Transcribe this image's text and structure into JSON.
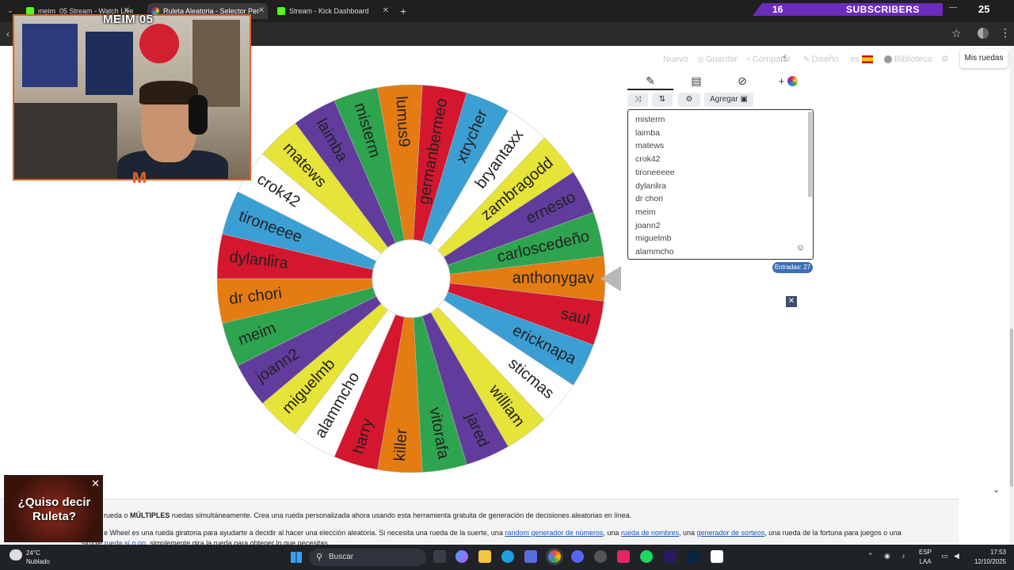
{
  "browser": {
    "tabs": [
      {
        "label": "meim_05 Stream - Watch Live o",
        "favicon_color": "#53fc18",
        "active": false
      },
      {
        "label": "Ruleta Aleatoria - Selector Per",
        "favicon_color": "#d946a8",
        "active": true
      },
      {
        "label": "Stream - Kick Dashboard",
        "favicon_color": "#53fc18",
        "active": false
      }
    ],
    "new_tab": "+"
  },
  "stream_overlay": {
    "streamer_name": "MEIM 05",
    "subscriber_count": "16",
    "subscriber_label": "SUBSCRIBERS",
    "corner_number": "25",
    "accent": "#6d2bbd",
    "frame_color": "#e0622a"
  },
  "site_menu": {
    "nuevo": "Nuevo",
    "guardar": "Guardar",
    "compartir": "Compartir",
    "diseno": "Diseño",
    "language": "es",
    "biblioteca": "Biblioteca",
    "mis_ruedas": "Mis ruedas"
  },
  "editor": {
    "tabs": [
      {
        "icon": "pencil-icon",
        "glyph": "✎"
      },
      {
        "icon": "clipboard-icon",
        "glyph": "📋"
      },
      {
        "icon": "eye-off-icon",
        "glyph": "◎"
      },
      {
        "icon": "add-color-icon",
        "glyph": "+"
      }
    ],
    "buttons": {
      "shuffle": "⤨",
      "sort": "⇅",
      "settings": "⚙",
      "add": "Agregar"
    },
    "entries": [
      "misterm",
      "laimba",
      "matews",
      "crok42",
      "tironeeeee",
      "dylanlira",
      "dr chori",
      "meim",
      "joann2",
      "miguelmb",
      "alammcho"
    ],
    "entries_badge": "Entradas: 27"
  },
  "wheel": {
    "colors": {
      "green": "#2ea44f",
      "orange": "#e47c12",
      "red": "#d4172f",
      "blue": "#3b9fd4",
      "white": "#ffffff",
      "yellow": "#e6e339",
      "purple": "#613c9c"
    },
    "segments": [
      {
        "label": "anthonygav",
        "color": "orange"
      },
      {
        "label": "saul",
        "color": "red"
      },
      {
        "label": "ericknapa",
        "color": "blue"
      },
      {
        "label": "sticmas",
        "color": "white"
      },
      {
        "label": "william",
        "color": "yellow"
      },
      {
        "label": "jared",
        "color": "purple"
      },
      {
        "label": "vitorafa",
        "color": "green"
      },
      {
        "label": "killer",
        "color": "orange"
      },
      {
        "label": "harry",
        "color": "red"
      },
      {
        "label": "alammcho",
        "color": "white"
      },
      {
        "label": "miguelmb",
        "color": "yellow"
      },
      {
        "label": "joann2",
        "color": "purple"
      },
      {
        "label": "meim",
        "color": "green"
      },
      {
        "label": "dr chori",
        "color": "orange"
      },
      {
        "label": "dylanlira",
        "color": "red"
      },
      {
        "label": "tironeeee",
        "color": "blue"
      },
      {
        "label": "crok42",
        "color": "white"
      },
      {
        "label": "matews",
        "color": "yellow"
      },
      {
        "label": "laimba",
        "color": "purple"
      },
      {
        "label": "misterm",
        "color": "green"
      },
      {
        "label": "lumus9",
        "color": "orange"
      },
      {
        "label": "germanbermeo",
        "color": "red"
      },
      {
        "label": "xtrycher",
        "color": "blue"
      },
      {
        "label": "bryantaxx",
        "color": "white"
      },
      {
        "label": "zambragodd",
        "color": "yellow"
      },
      {
        "label": "ernesto",
        "color": "purple"
      },
      {
        "label": "carloscedeño",
        "color": "green"
      }
    ]
  },
  "promo": {
    "text_line1": "¿Quiso decir",
    "text_line2": "Ruleta?"
  },
  "info": {
    "line1_pre": "rueda o ",
    "line1_bold": "MÚLTIPLES",
    "line1_post": " ruedas simultáneamente. Crea una rueda personalizada ahora usando esta herramienta gratuita de generación de decisiones aleatorias en línea.",
    "line2_pre": "e Wheel es una rueda giratoria para ayudarte a decidir al hacer una elección aleatoria. Si necesita una rueda de la suerte, una ",
    "link1": "random generador de números",
    "line2_mid1": ", una ",
    "link2": "rueda de nombres",
    "line2_mid2": ", una ",
    "link3": "generador de sorteos",
    "line2_post": ", una rueda de la fortuna para juegos o una",
    "line3_pre": "simple ",
    "link4": "rueda sí o no",
    "line3_post": ", simplemente gira la rueda para obtener lo que necesitas."
  },
  "taskbar": {
    "temperature": "24°C",
    "weather": "Nublado",
    "search_placeholder": "Buscar",
    "lang_line1": "ESP",
    "lang_line2": "LAA",
    "time": "17:53",
    "date": "12/10/2025"
  }
}
